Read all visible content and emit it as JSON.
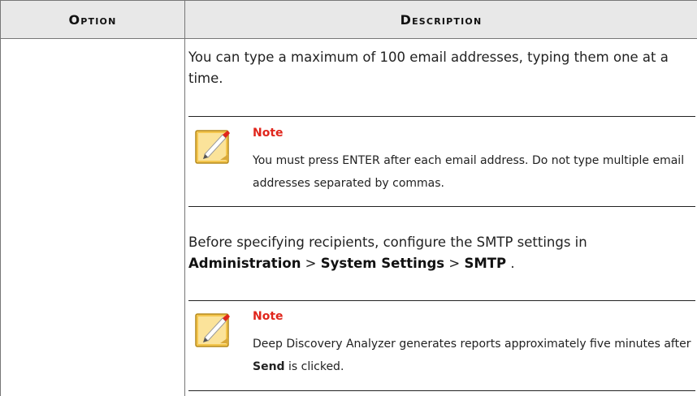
{
  "table": {
    "header": {
      "option": "Option",
      "description": "Description"
    },
    "paragraphs": {
      "p1": "You can type a maximum of 100 email addresses, typing them one at a time.",
      "p2_prefix": "Before specifying recipients, configure the SMTP settings in",
      "p2_admin": "Administration",
      "p2_sep1": " > ",
      "p2_system": "System Settings",
      "p2_sep2": " > ",
      "p2_smtp": "SMTP",
      "p2_end": " ."
    },
    "notes": [
      {
        "title": "Note",
        "body": "You must press ENTER after each email address. Do not type multiple email addresses separated by commas."
      },
      {
        "title": "Note",
        "body_prefix": "Deep Discovery Analyzer generates reports approximately five minutes after",
        "body_bold": "Send",
        "body_suffix": " is clicked."
      }
    ]
  },
  "icons": {
    "note": "note-pencil-icon"
  },
  "colors": {
    "note_title": "#e0261c",
    "header_bg": "#e8e8e8"
  }
}
